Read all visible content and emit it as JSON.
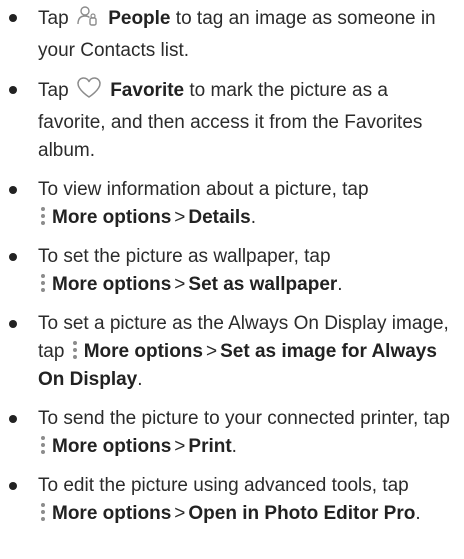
{
  "items": [
    {
      "tap": "Tap",
      "label": "People",
      "rest": "to tag an image as someone in your Contacts list."
    },
    {
      "tap": "Tap",
      "label": "Favorite",
      "rest": "to mark the picture as a favorite, and then access it from the Favorites album."
    },
    {
      "text": "To view information about a picture, tap",
      "more": "More options",
      "sep": ">",
      "target": "Details",
      "end": "."
    },
    {
      "text": "To set the picture as wallpaper, tap",
      "more": "More options",
      "sep": ">",
      "target": "Set as wallpaper",
      "end": "."
    },
    {
      "text": "To set a picture as the Always On Display image, tap",
      "more": "More options",
      "sep": ">",
      "target": "Set as image for Always On Display",
      "end": "."
    },
    {
      "text": "To send the picture to your connected printer, tap",
      "more": "More options",
      "sep": ">",
      "target": "Print",
      "end": "."
    },
    {
      "text": "To edit the picture using advanced tools, tap",
      "more": "More options",
      "sep": ">",
      "target": "Open in Photo Editor Pro",
      "end": "."
    }
  ],
  "icons": {
    "people": "people-icon",
    "favorite": "heart-icon",
    "more": "more-options-icon"
  },
  "colors": {
    "text": "#2b2b2b",
    "icon": "#8c8c8c"
  }
}
